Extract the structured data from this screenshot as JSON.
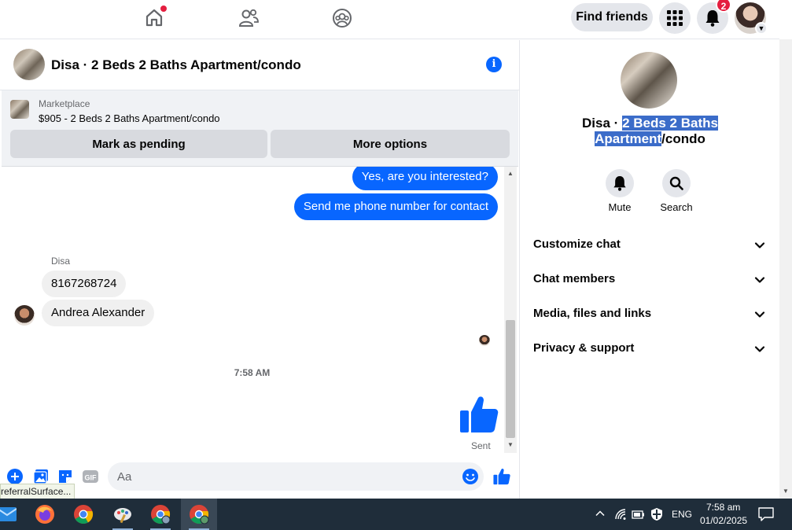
{
  "topbar": {
    "find_friends_label": "Find friends",
    "notification_count": "2"
  },
  "chat": {
    "title": "Disa · 2 Beds 2 Baths Apartment/condo",
    "marketplace_label": "Marketplace",
    "listing_price_title": "$905 - 2 Beds 2 Baths Apartment/condo",
    "mark_pending_label": "Mark as pending",
    "more_options_label": "More options",
    "messages": [
      {
        "direction": "outgoing",
        "text": "Yes, are you interested?"
      },
      {
        "direction": "outgoing",
        "text": "Send me phone number for contact"
      },
      {
        "direction": "incoming",
        "text": "8167268724"
      },
      {
        "direction": "incoming",
        "text": "Andrea Alexander"
      }
    ],
    "sender_name": "Disa",
    "time_separator": "7:58 AM",
    "sent_status": "Sent",
    "composer_placeholder": "Aa"
  },
  "info_panel": {
    "title_prefix": "Disa · ",
    "title_highlighted_1": "2 Beds 2 Baths",
    "title_highlighted_2": "Apartment",
    "title_suffix": "/condo",
    "mute_label": "Mute",
    "search_label": "Search",
    "sections": [
      "Customize chat",
      "Chat members",
      "Media, files and links",
      "Privacy & support"
    ]
  },
  "taskbar": {
    "tooltip_text": "referralSurface...",
    "language": "ENG",
    "time": "7:58 am",
    "date": "01/02/2025"
  },
  "colors": {
    "messenger_blue": "#0866ff",
    "notification_red": "#e41e3f",
    "selection_highlight": "#3b6cc9",
    "taskbar_bg": "#1f2d3a"
  }
}
